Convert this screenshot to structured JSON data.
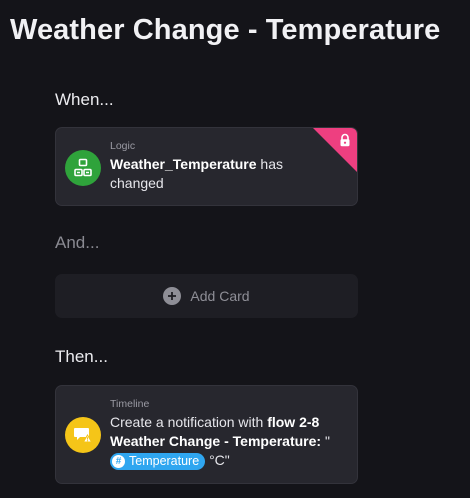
{
  "page": {
    "title": "Weather Change - Temperature"
  },
  "sections": {
    "when": "When...",
    "and": "And...",
    "then": "Then..."
  },
  "when_card": {
    "category": "Logic",
    "variable": "Weather_Temperature",
    "suffix_1": " has",
    "suffix_2": "changed",
    "icon": "logic-icon",
    "icon_color": "#2fa33b",
    "locked": true,
    "lock_color": "#ee3f80"
  },
  "and_section": {
    "add_card_label": "Add Card"
  },
  "then_card": {
    "category": "Timeline",
    "prefix": "Create a notification with ",
    "flow_bold": "flow 2-8",
    "line2_bold": "Weather Change - Temperature:",
    "line2_rest": " \"",
    "token_label": "Temperature",
    "line3_rest": " °C\"",
    "icon": "timeline-notification-icon",
    "icon_color": "#f5c518",
    "token_color": "#2fa6f0"
  }
}
